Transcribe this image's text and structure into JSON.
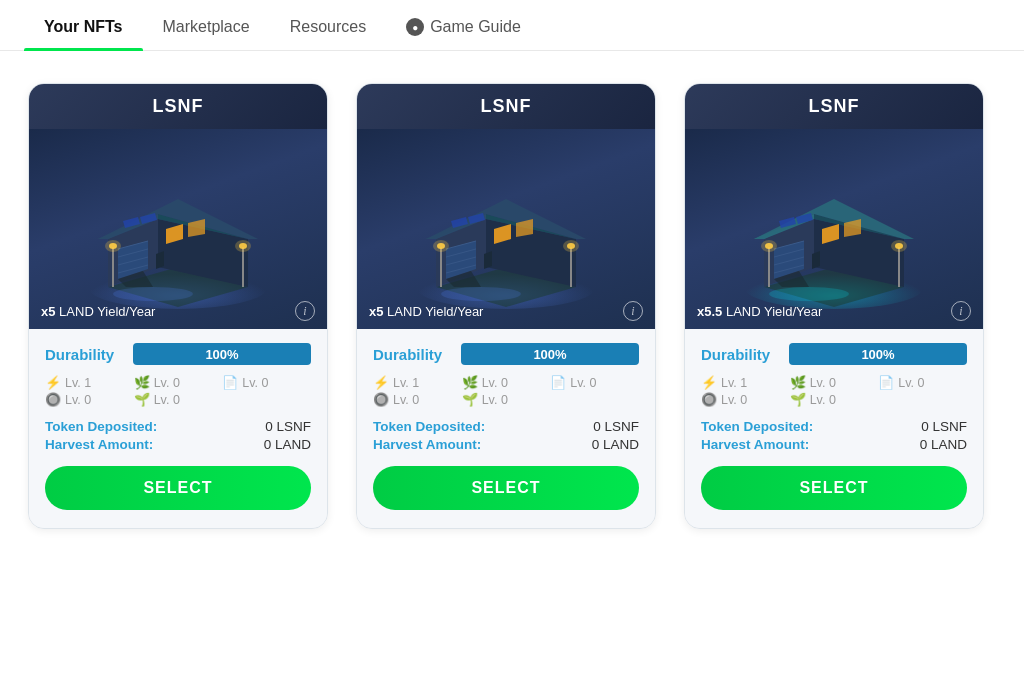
{
  "nav": {
    "items": [
      {
        "id": "your-nfts",
        "label": "Your NFTs",
        "active": true
      },
      {
        "id": "marketplace",
        "label": "Marketplace",
        "active": false
      },
      {
        "id": "resources",
        "label": "Resources",
        "active": false
      },
      {
        "id": "game-guide",
        "label": "Game Guide",
        "active": false,
        "hasIcon": true
      }
    ]
  },
  "cards": [
    {
      "id": "card-1",
      "title": "LSNF",
      "yield_num": "x5",
      "yield_label": "LAND Yield/Year",
      "durability_pct": "100%",
      "levels": [
        {
          "icon": "⚡",
          "label": "Lv. 1"
        },
        {
          "icon": "🌿",
          "label": "Lv. 0"
        },
        {
          "icon": "📄",
          "label": "Lv. 0"
        },
        {
          "icon": "🔘",
          "label": "Lv. 0"
        },
        {
          "icon": "🌱",
          "label": "Lv. 0"
        }
      ],
      "token_deposited_label": "Token Deposited:",
      "token_deposited_value": "0 LSNF",
      "harvest_amount_label": "Harvest Amount:",
      "harvest_amount_value": "0 LAND",
      "select_label": "SELECT",
      "hue": "blue"
    },
    {
      "id": "card-2",
      "title": "LSNF",
      "yield_num": "x5",
      "yield_label": "LAND Yield/Year",
      "durability_pct": "100%",
      "levels": [
        {
          "icon": "⚡",
          "label": "Lv. 1"
        },
        {
          "icon": "🌿",
          "label": "Lv. 0"
        },
        {
          "icon": "📄",
          "label": "Lv. 0"
        },
        {
          "icon": "🔘",
          "label": "Lv. 0"
        },
        {
          "icon": "🌱",
          "label": "Lv. 0"
        }
      ],
      "token_deposited_label": "Token Deposited:",
      "token_deposited_value": "0 LSNF",
      "harvest_amount_label": "Harvest Amount:",
      "harvest_amount_value": "0 LAND",
      "select_label": "SELECT",
      "hue": "blue"
    },
    {
      "id": "card-3",
      "title": "LSNF",
      "yield_num": "x5.5",
      "yield_label": "LAND Yield/Year",
      "durability_pct": "100%",
      "levels": [
        {
          "icon": "⚡",
          "label": "Lv. 1"
        },
        {
          "icon": "🌿",
          "label": "Lv. 0"
        },
        {
          "icon": "📄",
          "label": "Lv. 0"
        },
        {
          "icon": "🔘",
          "label": "Lv. 0"
        },
        {
          "icon": "🌱",
          "label": "Lv. 0"
        }
      ],
      "token_deposited_label": "Token Deposited:",
      "token_deposited_value": "0 LSNF",
      "harvest_amount_label": "Harvest Amount:",
      "harvest_amount_value": "0 LAND",
      "select_label": "SELECT",
      "hue": "cyan"
    }
  ]
}
